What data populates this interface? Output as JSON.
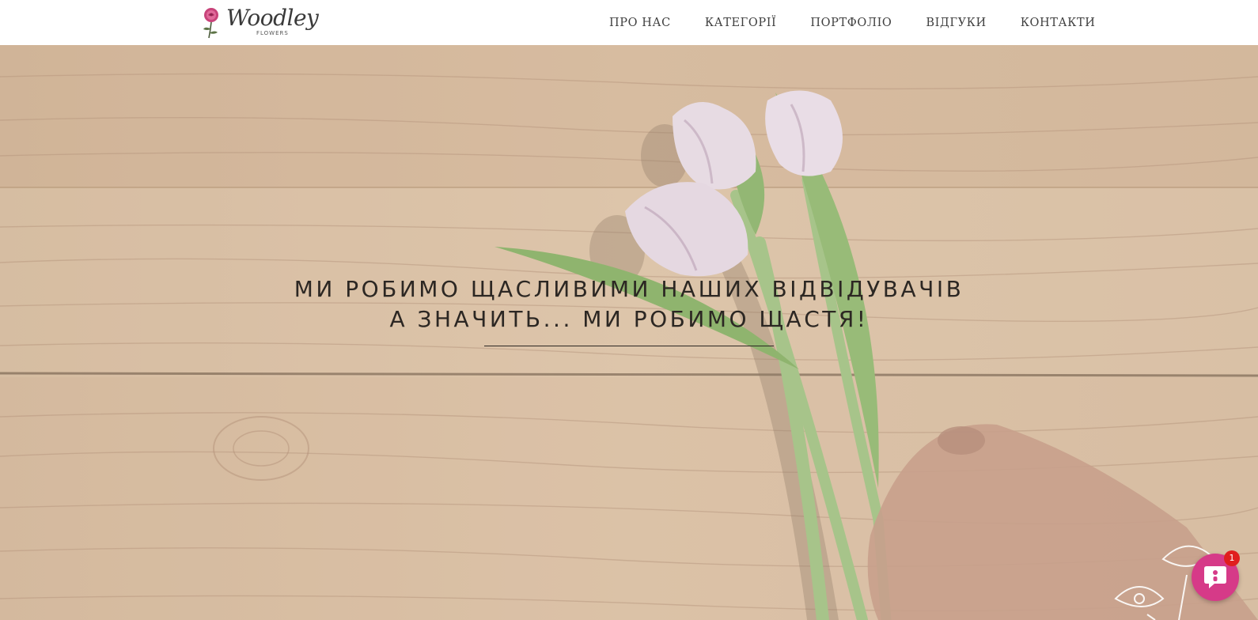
{
  "header": {
    "logo": {
      "word": "Woodley",
      "sub": "FLOWERS"
    },
    "nav": [
      {
        "label": "ПРО НАС"
      },
      {
        "label": "КАТЕГОРІЇ"
      },
      {
        "label": "ПОРТФОЛІО"
      },
      {
        "label": "ВІДГУКИ"
      },
      {
        "label": "КОНТАКТИ"
      }
    ]
  },
  "hero": {
    "line1": "МИ РОБИМО ЩАСЛИВИМИ НАШИХ ВІДВІДУВАЧІВ",
    "line2": "А ЗНАЧИТЬ... МИ РОБИМО ЩАСТЯ!",
    "background": "tulips-on-wooden-table"
  },
  "chat": {
    "badge_count": "1",
    "icon": "chat-bubble-icon",
    "accent": "#d63a88"
  },
  "colors": {
    "header_bg": "#ffffff",
    "nav_text": "#3f3f3f",
    "hero_text": "#2c2723",
    "wood": "#d8bfa6"
  }
}
